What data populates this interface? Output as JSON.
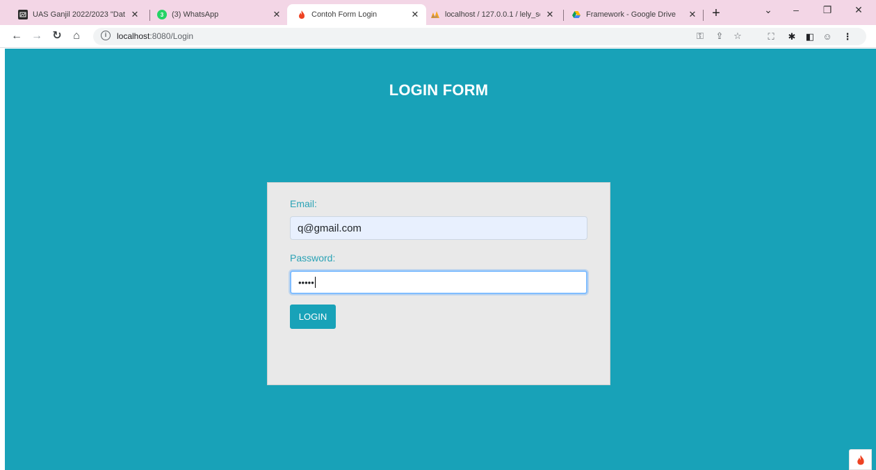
{
  "browser": {
    "tabs": [
      {
        "title": "UAS Ganjil 2022/2023 \"Datab",
        "favicon": "dark-square-icon"
      },
      {
        "title": "(3) WhatsApp",
        "favicon": "whatsapp-icon"
      },
      {
        "title": "Contoh Form Login",
        "favicon": "codeigniter-flame-icon",
        "active": true
      },
      {
        "title": "localhost / 127.0.0.1 / lely_so",
        "favicon": "phpmyadmin-icon"
      },
      {
        "title": "Framework - Google Drive",
        "favicon": "google-drive-icon"
      }
    ],
    "url_host": "localhost",
    "url_rest": ":8080/Login"
  },
  "page": {
    "heading": "LOGIN FORM",
    "email_label": "Email:",
    "email_value": "q@gmail.com",
    "password_label": "Password:",
    "password_masked": "•••••",
    "login_button": "LOGIN"
  },
  "colors": {
    "page_bg": "#18a2b8",
    "card_bg": "#e9e9e9",
    "label": "#2aa2b5",
    "tabstrip": "#f3d6e6"
  }
}
